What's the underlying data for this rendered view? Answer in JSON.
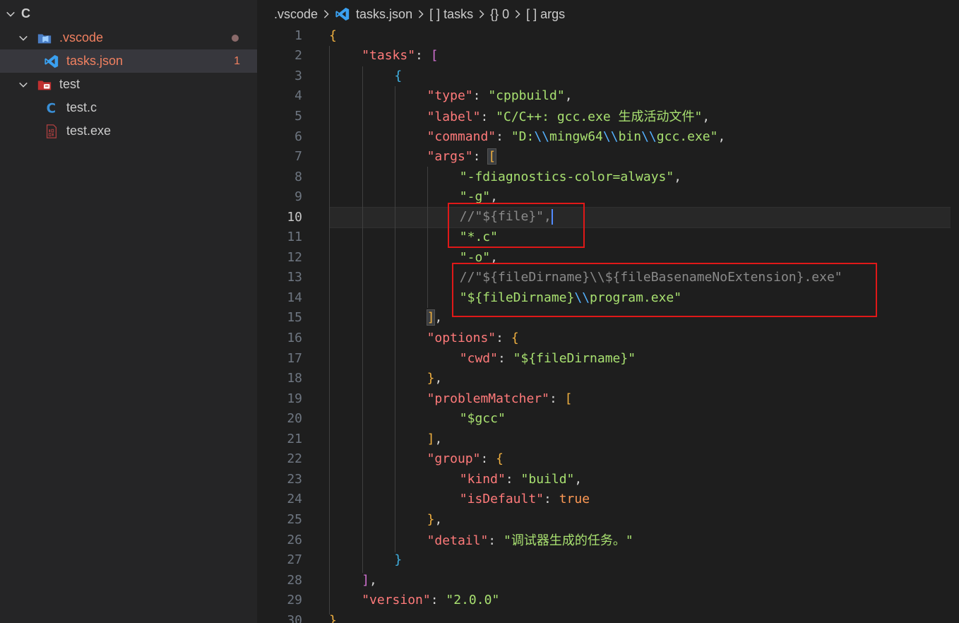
{
  "sidebar": {
    "root": {
      "label": "C"
    },
    "items": [
      {
        "label": ".vscode",
        "type": "folder",
        "color": "#f08060"
      },
      {
        "label": "tasks.json",
        "type": "file",
        "badge": "1",
        "color": "#f08060"
      },
      {
        "label": "test",
        "type": "folder",
        "color": "#cccccc"
      },
      {
        "label": "test.c",
        "type": "file",
        "color": "#cccccc"
      },
      {
        "label": "test.exe",
        "type": "file",
        "color": "#cccccc"
      }
    ]
  },
  "breadcrumb": {
    "items": [
      ".vscode",
      "tasks.json",
      "[ ] tasks",
      "{} 0",
      "[ ] args"
    ]
  },
  "editor": {
    "active_line": "10",
    "lines": [
      {
        "n": "1"
      },
      {
        "n": "2"
      },
      {
        "n": "3"
      },
      {
        "n": "4"
      },
      {
        "n": "5"
      },
      {
        "n": "6"
      },
      {
        "n": "7"
      },
      {
        "n": "8"
      },
      {
        "n": "9"
      },
      {
        "n": "10"
      },
      {
        "n": "11"
      },
      {
        "n": "12"
      },
      {
        "n": "13"
      },
      {
        "n": "14"
      },
      {
        "n": "15"
      },
      {
        "n": "16"
      },
      {
        "n": "17"
      },
      {
        "n": "18"
      },
      {
        "n": "19"
      },
      {
        "n": "20"
      },
      {
        "n": "21"
      },
      {
        "n": "22"
      },
      {
        "n": "23"
      },
      {
        "n": "24"
      },
      {
        "n": "25"
      },
      {
        "n": "26"
      },
      {
        "n": "27"
      },
      {
        "n": "28"
      },
      {
        "n": "29"
      },
      {
        "n": "30"
      }
    ],
    "text": {
      "open_brace": "{",
      "tasks_key": "\"tasks\"",
      "colon_sp": ": ",
      "open_bracket": "[",
      "obj_open": "{",
      "type_key": "\"type\"",
      "type_val": "\"cppbuild\"",
      "label_key": "\"label\"",
      "label_val": "\"C/C++: gcc.exe 生成活动文件\"",
      "command_key": "\"command\"",
      "command_val_a": "\"D:",
      "command_esc": "\\\\",
      "command_val_b": "mingw64",
      "command_val_c": "bin",
      "command_val_d": "gcc.exe\"",
      "args_key": "\"args\"",
      "arg1": "\"-fdiagnostics-color=always\"",
      "arg2": "\"-g\"",
      "arg3_comment": "//\"${file}\",",
      "arg4": "\"*.c\"",
      "arg5": "\"-o\"",
      "arg6_comment": "//\"${fileDirname}\\\\${fileBasenameNoExtension}.exe\"",
      "arg7_a": "\"${fileDirname}",
      "arg7_b": "program.exe\"",
      "args_close": "]",
      "options_key": "\"options\"",
      "cwd_key": "\"cwd\"",
      "cwd_val": "\"${fileDirname}\"",
      "close_obj": "}",
      "problem_key": "\"problemMatcher\"",
      "problem_val": "\"$gcc\"",
      "close_arr": "]",
      "group_key": "\"group\"",
      "kind_key": "\"kind\"",
      "kind_val": "\"build\"",
      "isdefault_key": "\"isDefault\"",
      "isdefault_val": "true",
      "detail_key": "\"detail\"",
      "detail_val": "\"调试器生成的任务。\"",
      "version_key": "\"version\"",
      "version_val": "\"2.0.0\"",
      "comma": ","
    }
  },
  "colors": {
    "key": "#ff7a7a",
    "string": "#a8e070",
    "comment": "#8a8a8a",
    "annotation_box": "#e01818"
  }
}
